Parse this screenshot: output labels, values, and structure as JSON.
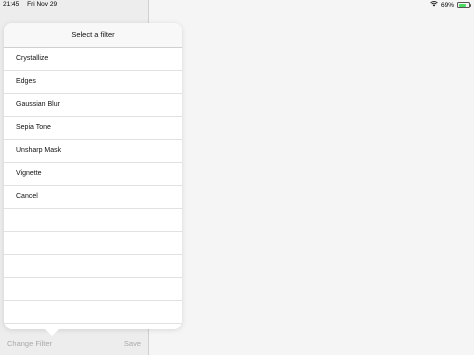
{
  "status_bar": {
    "time": "21:45",
    "date": "Fri Nov 29",
    "battery_percent": "69%",
    "battery_level": 0.69
  },
  "toolbar": {
    "change_filter_label": "Change Filter",
    "save_label": "Save"
  },
  "popover": {
    "title": "Select a filter",
    "options": [
      {
        "label": "Crystallize"
      },
      {
        "label": "Edges"
      },
      {
        "label": "Gaussian Blur"
      },
      {
        "label": "Sepia Tone"
      },
      {
        "label": "Unsharp Mask"
      },
      {
        "label": "Vignette"
      },
      {
        "label": "Cancel"
      }
    ]
  },
  "colors": {
    "battery_fill": "#4cd964",
    "toolbar_text_disabled": "#b0b0b0"
  },
  "icons": [
    "wifi-icon",
    "battery-icon"
  ]
}
